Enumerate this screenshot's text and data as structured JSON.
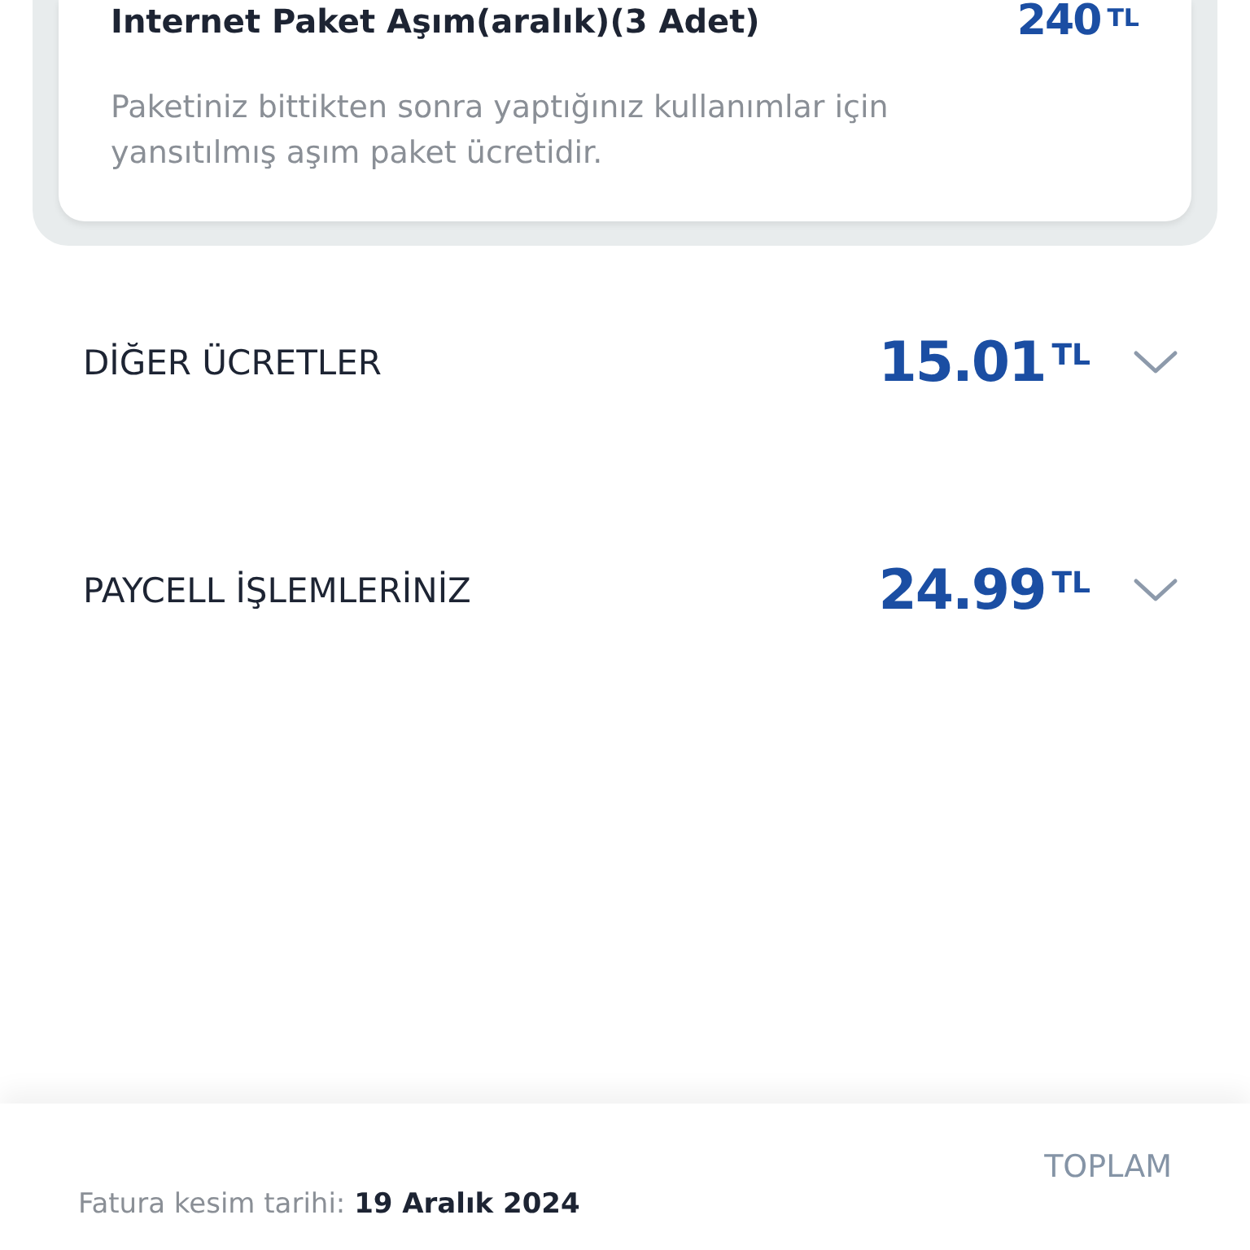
{
  "package_card": {
    "title": "Internet Paket Aşım(aralık)(3 Adet)",
    "amount": "240",
    "currency": "TL",
    "description": "Paketiniz bittikten sonra yaptığınız kullanımlar için yansıtılmış aşım paket ücretidir."
  },
  "sections": [
    {
      "title": "DİĞER ÜCRETLER",
      "amount": "15.01",
      "currency": "TL",
      "expanded": false
    },
    {
      "title": "PAYCELL İŞLEMLERİNİZ",
      "amount": "24.99",
      "currency": "TL",
      "expanded": false
    }
  ],
  "footer": {
    "date_label": "Fatura kesim tarihi:",
    "date_value": "19 Aralık 2024",
    "total_label": "TOPLAM"
  }
}
